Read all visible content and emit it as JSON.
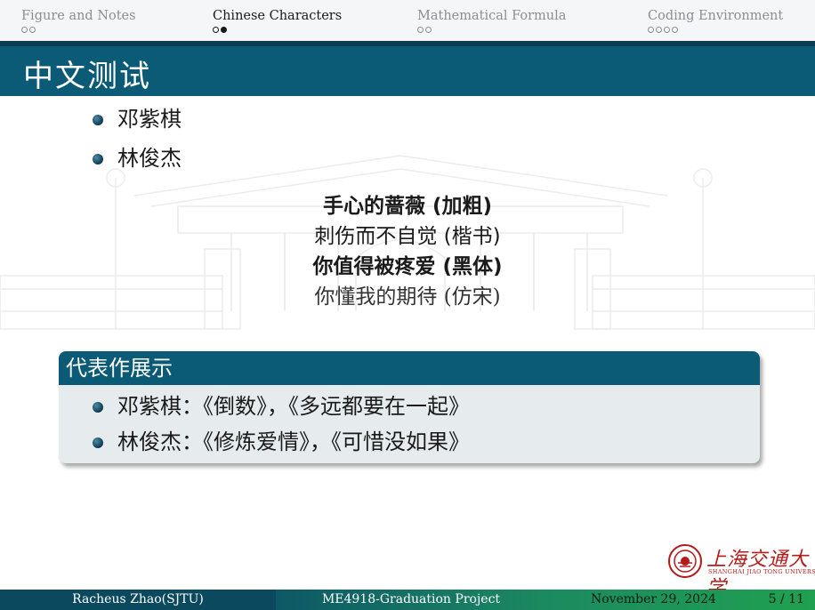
{
  "nav": {
    "sections": [
      {
        "label": "Figure and Notes",
        "dots": [
          "empty",
          "empty"
        ],
        "active": false
      },
      {
        "label": "Chinese Characters",
        "dots": [
          "current",
          "filled"
        ],
        "active": true
      },
      {
        "label": "Mathematical Formula",
        "dots": [
          "empty",
          "empty"
        ],
        "active": false
      },
      {
        "label": "Coding Environment",
        "dots": [
          "empty",
          "empty",
          "empty",
          "empty"
        ],
        "active": false
      }
    ]
  },
  "frame": {
    "title": "中文测试",
    "bullets": [
      "邓紫棋",
      "林俊杰"
    ],
    "lines": [
      {
        "text": "手心的蔷薇 (加粗)",
        "style": "bold"
      },
      {
        "text": "刺伤而不自觉 (楷书)",
        "style": "normal"
      },
      {
        "text": "你值得被疼爱 (黑体)",
        "style": "bold"
      },
      {
        "text": "你懂我的期待 (仿宋)",
        "style": "light"
      }
    ],
    "block": {
      "title": "代表作展示",
      "items": [
        "邓紫棋：《倒数》，《多远都要在一起》",
        "林俊杰：《修炼爱情》，《可惜没如果》"
      ]
    }
  },
  "logo": {
    "text": "上海交通大学",
    "sub": "SHANGHAI JIAO TONG UNIVERSITY"
  },
  "footer": {
    "author": "Racheus Zhao(SJTU)",
    "title": "ME4918-Graduation Project",
    "date": "November 29, 2024",
    "page": "5 / 11"
  },
  "colors": {
    "primary": "#0b5a76",
    "block_bg": "#e6ebee",
    "logo": "#b31b1b"
  }
}
